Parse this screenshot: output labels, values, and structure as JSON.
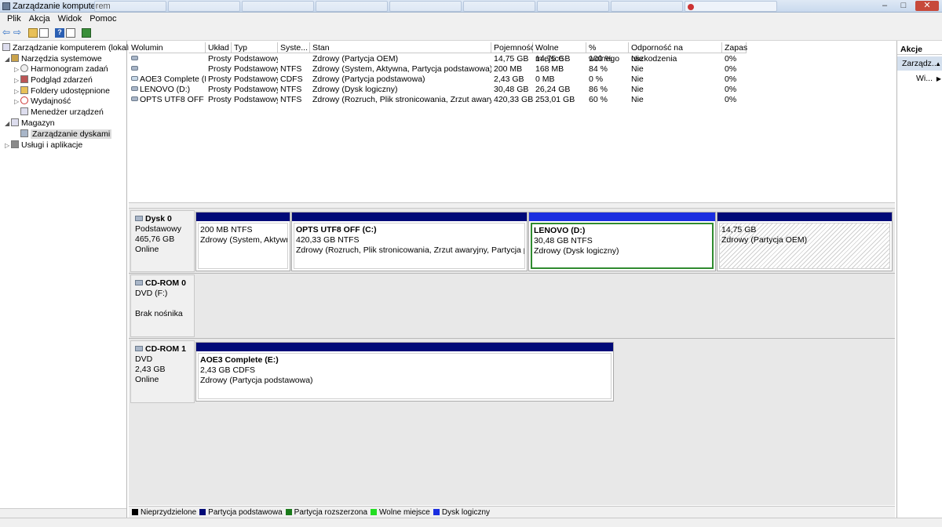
{
  "window": {
    "title": "Zarządzanie komputerem"
  },
  "menu": [
    "Plik",
    "Akcja",
    "Widok",
    "Pomoc"
  ],
  "tree": {
    "root": "Zarządzanie komputerem (lokalne)",
    "system_tools": "Narzędzia systemowe",
    "task_scheduler": "Harmonogram zadań",
    "event_viewer": "Podgląd zdarzeń",
    "shared_folders": "Foldery udostępnione",
    "performance": "Wydajność",
    "device_manager": "Menedżer urządzeń",
    "storage": "Magazyn",
    "disk_management": "Zarządzanie dyskami",
    "services": "Usługi i aplikacje"
  },
  "table": {
    "headers": [
      "Wolumin",
      "Układ",
      "Typ",
      "Syste...",
      "Stan",
      "Pojemność",
      "Wolne miejsce",
      "% wolnego",
      "Odporność na uszkodzenia",
      "Zapas"
    ],
    "rows": [
      {
        "name": "",
        "layout": "Prosty",
        "type": "Podstawowy",
        "fs": "",
        "status": "Zdrowy (Partycja OEM)",
        "capacity": "14,75 GB",
        "free": "14,75 GB",
        "pct": "100 %",
        "fault": "Nie",
        "overhead": "0%"
      },
      {
        "name": "",
        "layout": "Prosty",
        "type": "Podstawowy",
        "fs": "NTFS",
        "status": "Zdrowy (System, Aktywna, Partycja podstawowa)",
        "capacity": "200 MB",
        "free": "168 MB",
        "pct": "84 %",
        "fault": "Nie",
        "overhead": "0%"
      },
      {
        "name": "AOE3 Complete (E:)",
        "layout": "Prosty",
        "type": "Podstawowy",
        "fs": "CDFS",
        "status": "Zdrowy (Partycja podstawowa)",
        "capacity": "2,43 GB",
        "free": "0 MB",
        "pct": "0 %",
        "fault": "Nie",
        "overhead": "0%"
      },
      {
        "name": "LENOVO (D:)",
        "layout": "Prosty",
        "type": "Podstawowy",
        "fs": "NTFS",
        "status": "Zdrowy (Dysk logiczny)",
        "capacity": "30,48 GB",
        "free": "26,24 GB",
        "pct": "86 %",
        "fault": "Nie",
        "overhead": "0%"
      },
      {
        "name": "OPTS UTF8 OFF (C:)",
        "layout": "Prosty",
        "type": "Podstawowy",
        "fs": "NTFS",
        "status": "Zdrowy (Rozruch, Plik stronicowania, Zrzut awaryjny,...",
        "capacity": "420,33 GB",
        "free": "253,01 GB",
        "pct": "60 %",
        "fault": "Nie",
        "overhead": "0%"
      }
    ]
  },
  "disks": {
    "disk0": {
      "name": "Dysk 0",
      "kind": "Podstawowy",
      "size": "465,76 GB",
      "state": "Online",
      "parts": [
        {
          "title": "",
          "size": "200 MB NTFS",
          "status": "Zdrowy (System, Aktywna, Pa"
        },
        {
          "title": "OPTS UTF8 OFF  (C:)",
          "size": "420,33 GB NTFS",
          "status": "Zdrowy (Rozruch, Plik stronicowania, Zrzut awaryjny, Partycja podstawo"
        },
        {
          "title": "LENOVO  (D:)",
          "size": "30,48 GB NTFS",
          "status": "Zdrowy (Dysk logiczny)"
        },
        {
          "title": "",
          "size": "14,75 GB",
          "status": "Zdrowy (Partycja OEM)"
        }
      ]
    },
    "cdrom0": {
      "name": "CD-ROM 0",
      "kind": "DVD (F:)",
      "state": "Brak nośnika"
    },
    "cdrom1": {
      "name": "CD-ROM 1",
      "kind": "DVD",
      "size": "2,43 GB",
      "state": "Online",
      "part": {
        "title": "AOE3 Complete  (E:)",
        "size": "2,43 GB CDFS",
        "status": "Zdrowy (Partycja podstawowa)"
      }
    }
  },
  "legend": [
    {
      "label": "Nieprzydzielone",
      "color": "#000000"
    },
    {
      "label": "Partycja podstawowa",
      "color": "#000a78"
    },
    {
      "label": "Partycja rozszerzona",
      "color": "#1a7a1a"
    },
    {
      "label": "Wolne miejsce",
      "color": "#22dd22"
    },
    {
      "label": "Dysk logiczny",
      "color": "#1a2ee0"
    }
  ],
  "actions": {
    "header": "Akcje",
    "item1": "Zarządz...",
    "item2": "Wi..."
  }
}
